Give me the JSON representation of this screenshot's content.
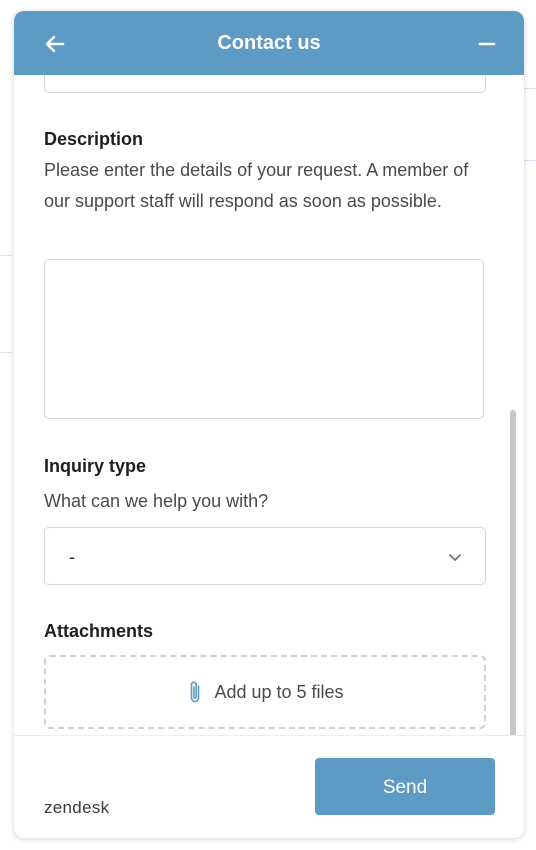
{
  "header": {
    "title": "Contact us",
    "back_icon": "arrow-left-icon",
    "minimize_icon": "minus-icon",
    "color": "#5d9ac4"
  },
  "form": {
    "description": {
      "label": "Description",
      "hint": "Please enter the details of your request. A member of our support staff will respond as soon as possible.",
      "value": ""
    },
    "inquiry_type": {
      "label": "Inquiry type",
      "hint": "What can we help you with?",
      "selected": "-",
      "icon": "chevron-down-icon"
    },
    "attachments": {
      "label": "Attachments",
      "dropzone_text": "Add up to 5 files",
      "icon": "paperclip-icon"
    }
  },
  "footer": {
    "brand": "zendesk",
    "send_label": "Send",
    "button_color": "#5d9ac4"
  }
}
